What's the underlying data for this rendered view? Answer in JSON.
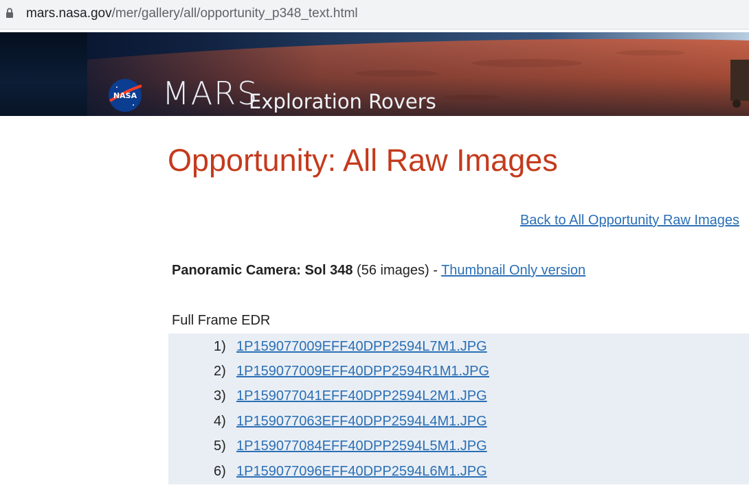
{
  "browser": {
    "url_host": "mars.nasa.gov",
    "url_path": "/mer/gallery/all/opportunity_p348_text.html"
  },
  "banner": {
    "mars_text": "MARS",
    "subtitle": "Exploration Rovers",
    "logo_text": "NASA"
  },
  "page": {
    "title": "Opportunity: All Raw Images",
    "back_link": "Back to All Opportunity Raw Images",
    "camera_label": "Panoramic Camera:",
    "sol_label": "Sol 348",
    "image_count": "(56 images) -",
    "thumbnail_link": "Thumbnail Only version",
    "section_heading": "Full Frame EDR"
  },
  "files": [
    {
      "index": "1)",
      "name": "1P159077009EFF40DPP2594L7M1.JPG"
    },
    {
      "index": "2)",
      "name": "1P159077009EFF40DPP2594R1M1.JPG"
    },
    {
      "index": "3)",
      "name": "1P159077041EFF40DPP2594L2M1.JPG"
    },
    {
      "index": "4)",
      "name": "1P159077063EFF40DPP2594L4M1.JPG"
    },
    {
      "index": "5)",
      "name": "1P159077084EFF40DPP2594L5M1.JPG"
    },
    {
      "index": "6)",
      "name": "1P159077096EFF40DPP2594L6M1.JPG"
    }
  ],
  "colors": {
    "title": "#c43a1c",
    "link": "#2a6fb5",
    "list_bg": "#e9eef4"
  }
}
